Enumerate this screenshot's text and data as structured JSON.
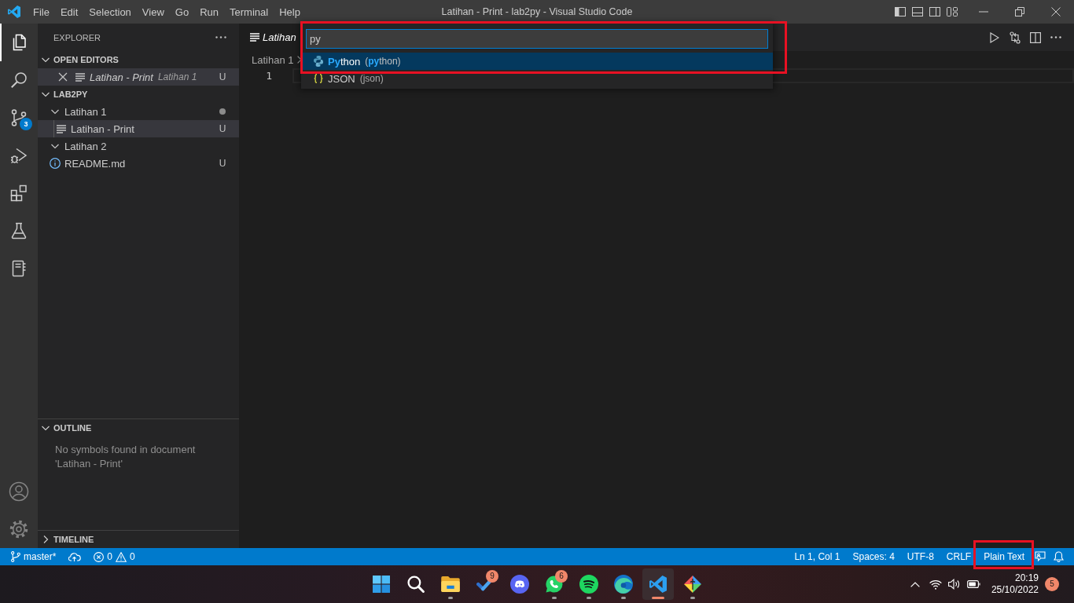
{
  "title_bar": {
    "menu": [
      "File",
      "Edit",
      "Selection",
      "View",
      "Go",
      "Run",
      "Terminal",
      "Help"
    ],
    "title": "Latihan - Print - lab2py - Visual Studio Code"
  },
  "activity_bar": {
    "items": [
      {
        "selected": true
      },
      {
        "selected": false
      },
      {
        "selected": false,
        "badge": "3"
      },
      {
        "selected": false
      },
      {
        "selected": false
      },
      {
        "selected": false
      },
      {
        "selected": false
      }
    ]
  },
  "sidebar": {
    "title": "EXPLORER",
    "open_editors": {
      "title": "OPEN EDITORS",
      "expanded": true,
      "items": [
        {
          "name": "Latihan - Print",
          "folder": "Latihan 1",
          "status": "U",
          "preview": true,
          "selected": true
        }
      ]
    },
    "workspace": {
      "title": "LAB2PY",
      "expanded": true,
      "tree": [
        {
          "name": "Latihan 1",
          "kind": "folder",
          "expanded": true,
          "changes": true,
          "selected": false,
          "children": [
            {
              "name": "Latihan - Print",
              "kind": "file",
              "status": "U",
              "changes": false,
              "selected": true
            }
          ]
        },
        {
          "name": "Latihan 2",
          "kind": "folder",
          "expanded": true,
          "changes": false,
          "selected": false
        },
        {
          "name": "README.md",
          "kind": "readme",
          "status": "U",
          "changes": false,
          "selected": false
        }
      ]
    },
    "outline": {
      "title": "OUTLINE",
      "expanded": true,
      "message": "No symbols found in document 'Latihan - Print'"
    },
    "timeline": {
      "title": "TIMELINE",
      "expanded": false
    }
  },
  "editor": {
    "tabs": [
      {
        "label": "Latihan",
        "preview": true,
        "selected": true
      }
    ],
    "breadcrumb": [
      "Latihan 1"
    ],
    "lines": [
      "1"
    ]
  },
  "quick_pick": {
    "value": "py",
    "highlighted": true,
    "items": [
      {
        "label": "**Py**thon",
        "description": "(**py**thon)",
        "selected": true
      },
      {
        "label": "JSON",
        "description": "(json)",
        "selected": false
      }
    ]
  },
  "status_bar": {
    "branch": "master*",
    "errors": "0",
    "warnings": "0",
    "items": [
      {
        "text": "Ln 1, Col 1",
        "highlighted": false
      },
      {
        "text": "Spaces: 4",
        "highlighted": false
      },
      {
        "text": "UTF-8",
        "highlighted": false
      },
      {
        "text": "CRLF",
        "highlighted": false
      },
      {
        "text": "Plain Text",
        "highlighted": true
      }
    ]
  },
  "taskbar": {
    "apps": [
      {
        "running": false,
        "selected": false
      },
      {
        "running": false,
        "selected": false
      },
      {
        "running": true,
        "selected": false
      },
      {
        "badge": "9",
        "running": false,
        "selected": false
      },
      {
        "running": false,
        "selected": false
      },
      {
        "badge": "6",
        "running": true,
        "selected": false
      },
      {
        "running": true,
        "selected": false
      },
      {
        "running": true,
        "selected": false
      },
      {
        "running": true,
        "selected": true
      },
      {
        "running": true,
        "selected": false
      }
    ],
    "time": "20:19",
    "date": "25/10/2022",
    "notifications": "5"
  }
}
